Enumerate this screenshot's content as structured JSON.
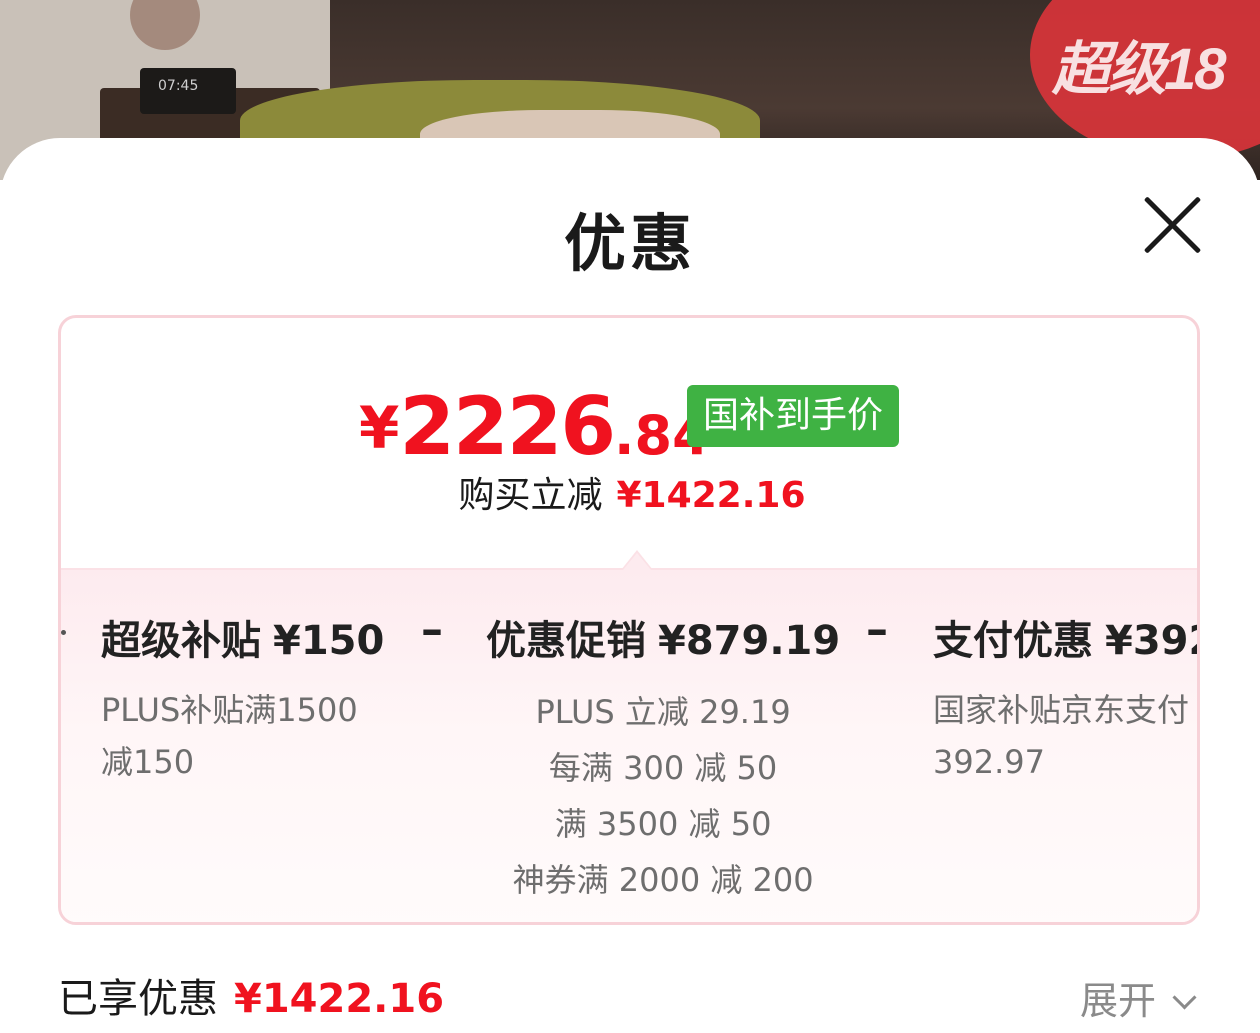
{
  "backdrop": {
    "badge_text": "超级18",
    "clock_text": "07:45"
  },
  "sheet": {
    "title": "优惠"
  },
  "price_card": {
    "currency": "¥",
    "price_integer": "2226",
    "price_decimal": ".84",
    "price_tag": "国补到手价",
    "instant_label": "购买立减",
    "instant_amount": "¥1422.16"
  },
  "breakdown": {
    "columns": [
      {
        "title": "超级补贴",
        "amount": "¥150",
        "lines": [
          "PLUS补贴满1500",
          "减150"
        ]
      },
      {
        "title": "优惠促销",
        "amount": "¥879.19",
        "lines": [
          "PLUS 立减 29.19",
          "每满 300 减 50",
          "满 3500 减 50",
          "神券满 2000 减 200"
        ]
      },
      {
        "title": "支付优惠",
        "amount": "¥392",
        "lines": [
          "国家补贴京东支付",
          "392.97"
        ]
      }
    ],
    "operator": "–"
  },
  "summary": {
    "label": "已享优惠",
    "amount": "¥1422.16",
    "expand_label": "展开"
  },
  "colors": {
    "accent_red": "#f0121f",
    "tag_green": "#3fb243",
    "card_border": "#f7d2d8"
  }
}
